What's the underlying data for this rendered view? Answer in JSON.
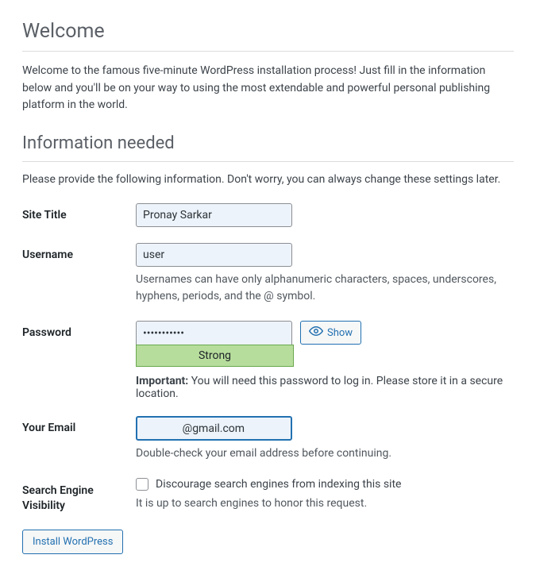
{
  "welcome": {
    "heading": "Welcome",
    "intro": "Welcome to the famous five-minute WordPress installation process! Just fill in the information below and you'll be on your way to using the most extendable and powerful personal publishing platform in the world."
  },
  "info": {
    "heading": "Information needed",
    "subhead": "Please provide the following information. Don't worry, you can always change these settings later."
  },
  "form": {
    "site_title": {
      "label": "Site Title",
      "value": "Pronay Sarkar"
    },
    "username": {
      "label": "Username",
      "value": "user",
      "helper": "Usernames can have only alphanumeric characters, spaces, underscores, hyphens, periods, and the @ symbol."
    },
    "password": {
      "label": "Password",
      "value": "•••••••••••",
      "show_label": "Show",
      "strength": "Strong",
      "important_label": "Important:",
      "important_text": " You will need this password to log in. Please store it in a secure location."
    },
    "email": {
      "label": "Your Email",
      "value": "              @gmail.com",
      "helper": "Double-check your email address before continuing."
    },
    "search": {
      "label": "Search Engine Visibility",
      "checkbox_label": "Discourage search engines from indexing this site",
      "helper": "It is up to search engines to honor this request."
    }
  },
  "submit": {
    "label": "Install WordPress"
  }
}
